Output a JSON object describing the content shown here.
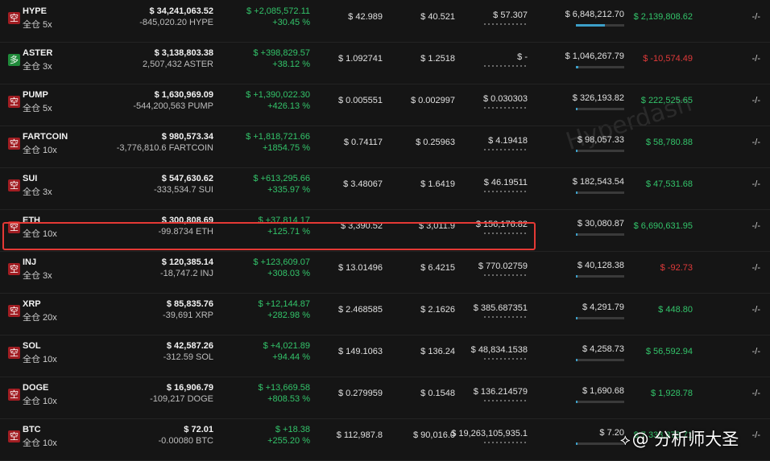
{
  "positions": [
    {
      "asset": "HYPE",
      "badge": "空",
      "side": "short",
      "margin_mode": "全仓 5x",
      "value_usd": "$ 34,241,063.52",
      "size": "-845,020.20 HYPE",
      "pnl": "$ +2,085,572.11",
      "pnl_pct": "+30.45 %",
      "entry": "$ 42.989",
      "mark": "$ 40.521",
      "liq": "$ 57.307",
      "margin_used": "$ 6,848,212.70",
      "margin_ratio": 0.6,
      "funding": "$ 2,139,808.62",
      "funding_sign": "pos",
      "tpsl": "-/-"
    },
    {
      "asset": "ASTER",
      "badge": "多",
      "side": "long",
      "margin_mode": "全仓 3x",
      "value_usd": "$ 3,138,803.38",
      "size": "2,507,432 ASTER",
      "pnl": "$ +398,829.57",
      "pnl_pct": "+38.12 %",
      "entry": "$ 1.092741",
      "mark": "$ 1.2518",
      "liq": "$ -",
      "margin_used": "$ 1,046,267.79",
      "margin_ratio": 0.05,
      "funding": "$ -10,574.49",
      "funding_sign": "neg",
      "tpsl": "-/-"
    },
    {
      "asset": "PUMP",
      "badge": "空",
      "side": "short",
      "margin_mode": "全仓 5x",
      "value_usd": "$ 1,630,969.09",
      "size": "-544,200,563 PUMP",
      "pnl": "$ +1,390,022.30",
      "pnl_pct": "+426.13 %",
      "entry": "$ 0.005551",
      "mark": "$ 0.002997",
      "liq": "$ 0.030303",
      "margin_used": "$ 326,193.82",
      "margin_ratio": 0.03,
      "funding": "$ 222,525.65",
      "funding_sign": "pos",
      "tpsl": "-/-"
    },
    {
      "asset": "FARTCOIN",
      "badge": "空",
      "side": "short",
      "margin_mode": "全仓 10x",
      "value_usd": "$ 980,573.34",
      "size": "-3,776,810.6 FARTCOIN",
      "pnl": "$ +1,818,721.66",
      "pnl_pct": "+1854.75 %",
      "entry": "$ 0.74117",
      "mark": "$ 0.25963",
      "liq": "$ 4.19418",
      "margin_used": "$ 98,057.33",
      "margin_ratio": 0.02,
      "funding": "$ 58,780.88",
      "funding_sign": "pos",
      "tpsl": "-/-"
    },
    {
      "asset": "SUI",
      "badge": "空",
      "side": "short",
      "margin_mode": "全仓 3x",
      "value_usd": "$ 547,630.62",
      "size": "-333,534.7 SUI",
      "pnl": "$ +613,295.66",
      "pnl_pct": "+335.97 %",
      "entry": "$ 3.48067",
      "mark": "$ 1.6419",
      "liq": "$ 46.19511",
      "margin_used": "$ 182,543.54",
      "margin_ratio": 0.02,
      "funding": "$ 47,531.68",
      "funding_sign": "pos",
      "tpsl": "-/-"
    },
    {
      "asset": "ETH",
      "badge": "空",
      "side": "short",
      "margin_mode": "全仓 10x",
      "value_usd": "$ 300,808.69",
      "size": "-99.8734 ETH",
      "pnl": "$ +37,814.17",
      "pnl_pct": "+125.71 %",
      "entry": "$ 3,390.52",
      "mark": "$ 3,011.9",
      "liq": "$ 156,176.82",
      "margin_used": "$ 30,080.87",
      "margin_ratio": 0.01,
      "funding": "$ 6,690,631.95",
      "funding_sign": "pos",
      "tpsl": "-/-"
    },
    {
      "asset": "INJ",
      "badge": "空",
      "side": "short",
      "margin_mode": "全仓 3x",
      "value_usd": "$ 120,385.14",
      "size": "-18,747.2 INJ",
      "pnl": "$ +123,609.07",
      "pnl_pct": "+308.03 %",
      "entry": "$ 13.01496",
      "mark": "$ 6.4215",
      "liq": "$ 770.02759",
      "margin_used": "$ 40,128.38",
      "margin_ratio": 0.01,
      "funding": "$ -92.73",
      "funding_sign": "neg",
      "tpsl": "-/-"
    },
    {
      "asset": "XRP",
      "badge": "空",
      "side": "short",
      "margin_mode": "全仓 20x",
      "value_usd": "$ 85,835.76",
      "size": "-39,691 XRP",
      "pnl": "$ +12,144.87",
      "pnl_pct": "+282.98 %",
      "entry": "$ 2.468585",
      "mark": "$ 2.1626",
      "liq": "$ 385.687351",
      "margin_used": "$ 4,291.79",
      "margin_ratio": 0.01,
      "funding": "$ 448.80",
      "funding_sign": "pos",
      "tpsl": "-/-"
    },
    {
      "asset": "SOL",
      "badge": "空",
      "side": "short",
      "margin_mode": "全仓 10x",
      "value_usd": "$ 42,587.26",
      "size": "-312.59 SOL",
      "pnl": "$ +4,021.89",
      "pnl_pct": "+94.44 %",
      "entry": "$ 149.1063",
      "mark": "$ 136.24",
      "liq": "$ 48,834.1538",
      "margin_used": "$ 4,258.73",
      "margin_ratio": 0.01,
      "funding": "$ 56,592.94",
      "funding_sign": "pos",
      "tpsl": "-/-"
    },
    {
      "asset": "DOGE",
      "badge": "空",
      "side": "short",
      "margin_mode": "全仓 10x",
      "value_usd": "$ 16,906.79",
      "size": "-109,217 DOGE",
      "pnl": "$ +13,669.58",
      "pnl_pct": "+808.53 %",
      "entry": "$ 0.279959",
      "mark": "$ 0.1548",
      "liq": "$ 136.214579",
      "margin_used": "$ 1,690.68",
      "margin_ratio": 0.01,
      "funding": "$ 1,928.78",
      "funding_sign": "pos",
      "tpsl": "-/-"
    },
    {
      "asset": "BTC",
      "badge": "空",
      "side": "short",
      "margin_mode": "全仓 10x",
      "value_usd": "$ 72.01",
      "size": "-0.00080 BTC",
      "pnl": "$ +18.38",
      "pnl_pct": "+255.20 %",
      "entry": "$ 112,987.8",
      "mark": "$ 90,016.0",
      "liq": "$ 19,263,105,935.1",
      "margin_used": "$ 7.20",
      "margin_ratio": 0.01,
      "funding": "$ 7,333,873.71",
      "funding_sign": "pos",
      "tpsl": "-/-"
    }
  ],
  "watermark": {
    "text": "@ 分析师大圣",
    "icon": "diamond-logo-icon"
  },
  "background_logo_text": "Hyperdash",
  "colors": {
    "positive": "#33c46a",
    "negative": "#e03a3a",
    "short_badge": "#a11d22",
    "long_badge": "#1f8a3a",
    "highlight": "#e53935"
  }
}
